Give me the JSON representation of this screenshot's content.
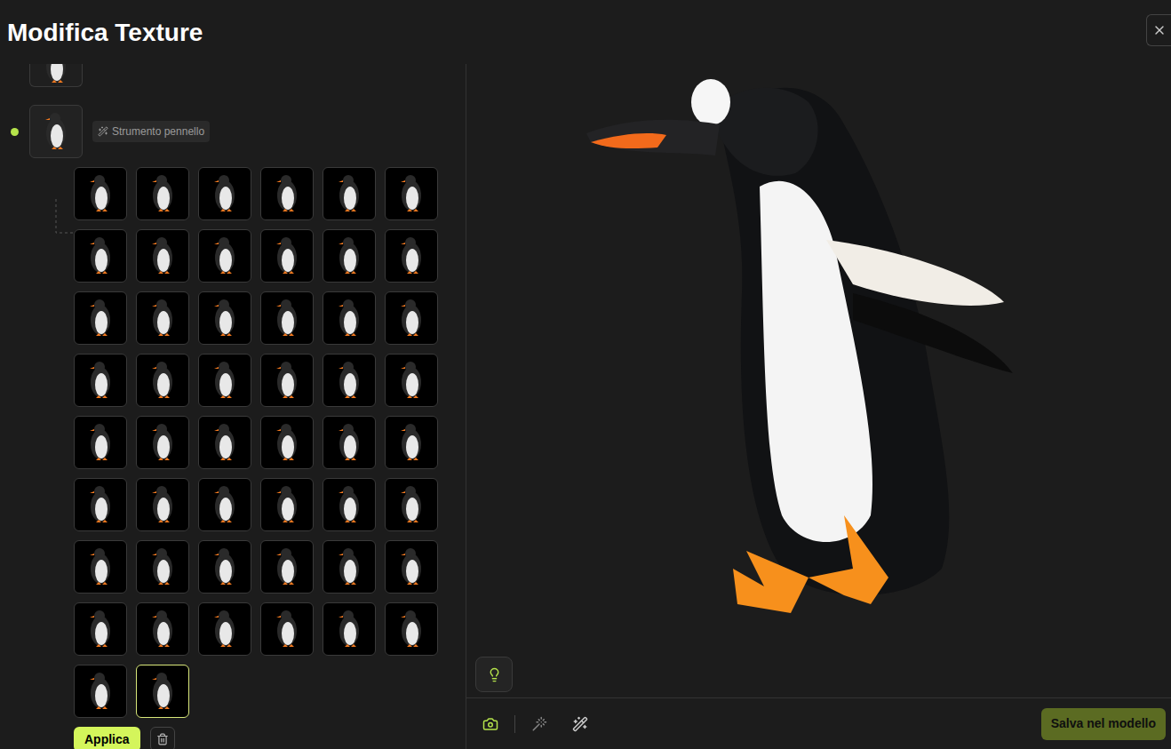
{
  "window": {
    "title": "Modifica Texture"
  },
  "tree": {
    "node": {
      "label": "Strumento pennello",
      "active": true
    }
  },
  "thumbnails": [
    {
      "selected": false
    },
    {
      "selected": false
    },
    {
      "selected": false
    },
    {
      "selected": false
    },
    {
      "selected": false
    },
    {
      "selected": false
    },
    {
      "selected": false
    },
    {
      "selected": false
    },
    {
      "selected": false
    },
    {
      "selected": false
    },
    {
      "selected": false
    },
    {
      "selected": false
    },
    {
      "selected": false
    },
    {
      "selected": false
    },
    {
      "selected": false
    },
    {
      "selected": false
    },
    {
      "selected": false
    },
    {
      "selected": false
    },
    {
      "selected": false
    },
    {
      "selected": false
    },
    {
      "selected": false
    },
    {
      "selected": false
    },
    {
      "selected": false
    },
    {
      "selected": false
    },
    {
      "selected": false
    },
    {
      "selected": false
    },
    {
      "selected": false
    },
    {
      "selected": false
    },
    {
      "selected": false
    },
    {
      "selected": false
    },
    {
      "selected": false
    },
    {
      "selected": false
    },
    {
      "selected": false
    },
    {
      "selected": false
    },
    {
      "selected": false
    },
    {
      "selected": false
    },
    {
      "selected": false
    },
    {
      "selected": false
    },
    {
      "selected": false
    },
    {
      "selected": false
    },
    {
      "selected": false
    },
    {
      "selected": false
    },
    {
      "selected": false
    },
    {
      "selected": false
    },
    {
      "selected": false
    },
    {
      "selected": false
    },
    {
      "selected": false
    },
    {
      "selected": false
    },
    {
      "selected": false
    },
    {
      "selected": true
    }
  ],
  "actions": {
    "apply": "Applica"
  },
  "viewport": {
    "save": "Salva nel modello"
  }
}
